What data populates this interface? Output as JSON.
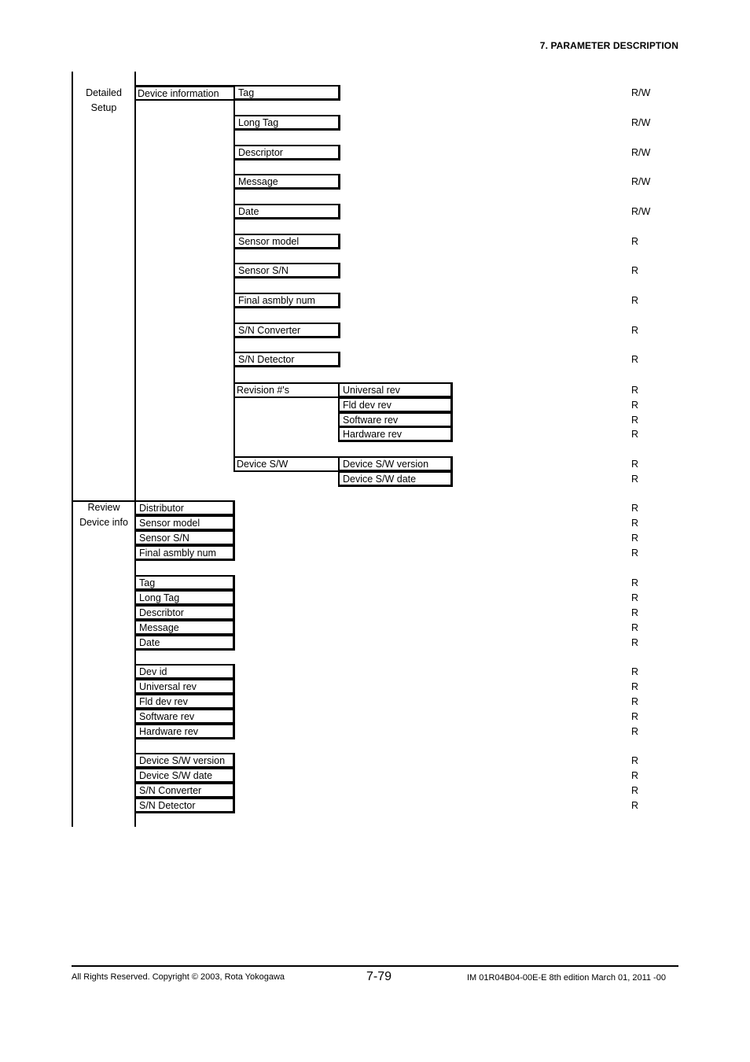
{
  "header": {
    "section_title": "7.  PARAMETER DESCRIPTION"
  },
  "detailed_setup": {
    "label_line1": "Detailed",
    "label_line2": "Setup",
    "group_label": "Device information",
    "items": [
      {
        "label": "Tag",
        "access": "R/W"
      },
      {
        "label": "Long Tag",
        "access": "R/W"
      },
      {
        "label": "Descriptor",
        "access": "R/W"
      },
      {
        "label": "Message",
        "access": "R/W"
      },
      {
        "label": "Date",
        "access": "R/W"
      },
      {
        "label": "Sensor model",
        "access": "R"
      },
      {
        "label": "Sensor S/N",
        "access": "R"
      },
      {
        "label": "Final asmbly num",
        "access": "R"
      },
      {
        "label": "S/N Converter",
        "access": "R"
      },
      {
        "label": "S/N Detector",
        "access": "R"
      }
    ],
    "revisions": {
      "label": "Revision #'s",
      "items": [
        {
          "label": "Universal rev",
          "access": "R"
        },
        {
          "label": "Fld dev rev",
          "access": "R"
        },
        {
          "label": "Software rev",
          "access": "R"
        },
        {
          "label": "Hardware rev",
          "access": "R"
        }
      ]
    },
    "device_sw": {
      "label": "Device S/W",
      "items": [
        {
          "label": "Device S/W version",
          "access": "R"
        },
        {
          "label": "Device S/W date",
          "access": "R"
        }
      ]
    }
  },
  "review": {
    "label_line1": "Review",
    "label_line2": "Device info",
    "groups": [
      [
        {
          "label": "Distributor",
          "access": "R"
        },
        {
          "label": "Sensor model",
          "access": "R"
        },
        {
          "label": "Sensor S/N",
          "access": "R"
        },
        {
          "label": "Final asmbly num",
          "access": "R"
        }
      ],
      [
        {
          "label": "Tag",
          "access": "R"
        },
        {
          "label": "Long Tag",
          "access": "R"
        },
        {
          "label": "Describtor",
          "access": "R"
        },
        {
          "label": "Message",
          "access": "R"
        },
        {
          "label": "Date",
          "access": "R"
        }
      ],
      [
        {
          "label": "Dev id",
          "access": "R"
        },
        {
          "label": "Universal rev",
          "access": "R"
        },
        {
          "label": "Fld dev rev",
          "access": "R"
        },
        {
          "label": "Software rev",
          "access": "R"
        },
        {
          "label": "Hardware rev",
          "access": "R"
        }
      ],
      [
        {
          "label": "Device S/W version",
          "access": "R"
        },
        {
          "label": "Device S/W date",
          "access": "R"
        },
        {
          "label": "S/N Converter",
          "access": "R"
        },
        {
          "label": "S/N Detector",
          "access": "R"
        }
      ]
    ]
  },
  "footer": {
    "copyright": "All Rights Reserved. Copyright © 2003, Rota Yokogawa",
    "page_number": "7-79",
    "doc_id": "IM 01R04B04-00E-E  8th edition March 01, 2011 -00"
  }
}
